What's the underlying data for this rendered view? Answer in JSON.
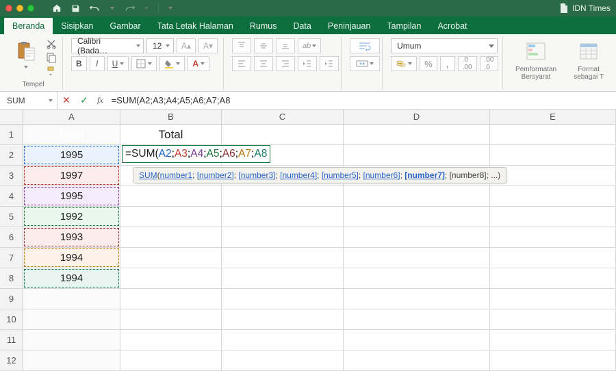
{
  "window": {
    "doc_name": "IDN Times"
  },
  "tabs": {
    "items": [
      "Beranda",
      "Sisipkan",
      "Gambar",
      "Tata Letak Halaman",
      "Rumus",
      "Data",
      "Peninjauan",
      "Tampilan",
      "Acrobat"
    ],
    "active_index": 0
  },
  "ribbon": {
    "paste_label": "Tempel",
    "font_name": "Calibri (Bada…",
    "font_size": "12",
    "number_format": "Umum",
    "cond_format": "Pemformatan Bersyarat",
    "format_table": "Format sebagai T"
  },
  "formula_bar": {
    "name_box": "SUM",
    "formula_text": "=SUM(A2;A3;A4;A5;A6;A7;A8"
  },
  "grid": {
    "columns": [
      "A",
      "B",
      "C",
      "D",
      "E"
    ],
    "rows": [
      1,
      2,
      3,
      4,
      5,
      6,
      7,
      8,
      9,
      10,
      11,
      12
    ],
    "headers": {
      "A1": "Data",
      "B1": "Total"
    },
    "data_A": [
      "1995",
      "1997",
      "1995",
      "1992",
      "1993",
      "1994",
      "1994"
    ]
  },
  "formula_cell": {
    "prefix": "=SUM(",
    "args": [
      "A2",
      "A3",
      "A4",
      "A5",
      "A6",
      "A7",
      "A8"
    ]
  },
  "tooltip": {
    "fn": "SUM",
    "params": [
      "number1",
      "[number2]",
      "[number3]",
      "[number4]",
      "[number5]",
      "[number6]",
      "[number7]",
      "[number8]; ..."
    ],
    "bold_index": 6
  }
}
